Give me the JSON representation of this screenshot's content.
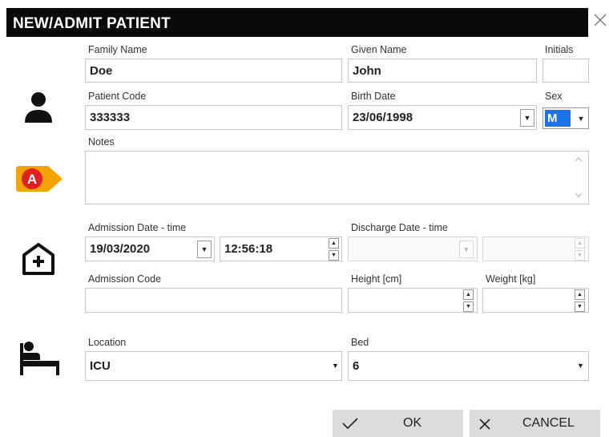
{
  "window": {
    "title": "NEW/ADMIT PATIENT",
    "close_icon": "close-icon"
  },
  "patient": {
    "family_name_label": "Family Name",
    "family_name": "Doe",
    "given_name_label": "Given Name",
    "given_name": "John",
    "initials_label": "Initials",
    "initials": "",
    "patient_code_label": "Patient Code",
    "patient_code": "333333",
    "birth_date_label": "Birth Date",
    "birth_date": "23/06/1998",
    "sex_label": "Sex",
    "sex": "M",
    "notes_label": "Notes",
    "notes": ""
  },
  "admission": {
    "admission_label": "Admission Date - time",
    "admission_date": "19/03/2020",
    "admission_time": "12:56:18",
    "discharge_label": "Discharge Date - time",
    "discharge_date": "",
    "discharge_time": "",
    "admission_code_label": "Admission Code",
    "admission_code": "",
    "height_label": "Height [cm]",
    "height": "",
    "weight_label": "Weight [kg]",
    "weight": ""
  },
  "placement": {
    "location_label": "Location",
    "location": "ICU",
    "bed_label": "Bed",
    "bed": "6"
  },
  "buttons": {
    "ok_label": "OK",
    "cancel_label": "CANCEL"
  },
  "colors": {
    "title_bar": "#0a0a0a",
    "alert_badge": "#f5a300",
    "alert_letter": "#e02020",
    "selection": "#1a73e8"
  },
  "icons": [
    "person-icon",
    "alert-a-icon",
    "hospital-plus-icon",
    "bed-icon",
    "checkmark-icon",
    "x-icon"
  ]
}
